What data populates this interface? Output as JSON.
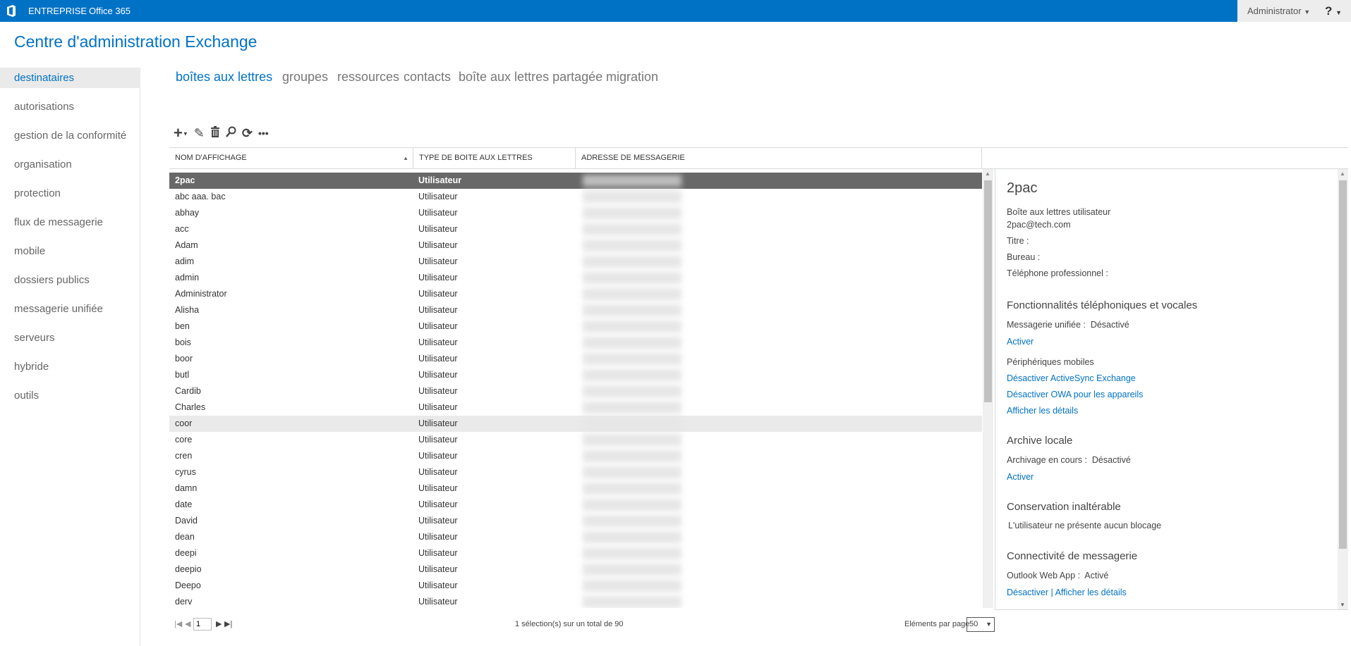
{
  "topbar": {
    "brand1": "ENTREPRISE",
    "brand2": "Office 365",
    "user": "Administrator",
    "help": "?",
    "logo_icon": "office-logo-icon",
    "accent": "#0072c6"
  },
  "title": "Centre d'administration Exchange",
  "sidebar": {
    "items": [
      {
        "label": "destinataires",
        "selected": true
      },
      {
        "label": "autorisations"
      },
      {
        "label": "gestion de la conformité"
      },
      {
        "label": "organisation"
      },
      {
        "label": "protection"
      },
      {
        "label": "flux de messagerie"
      },
      {
        "label": "mobile"
      },
      {
        "label": "dossiers publics"
      },
      {
        "label": "messagerie unifiée"
      },
      {
        "label": "serveurs"
      },
      {
        "label": "hybride"
      },
      {
        "label": "outils"
      }
    ]
  },
  "tabs": [
    {
      "label": "boîtes aux lettres",
      "selected": true
    },
    {
      "label": "groupes"
    },
    {
      "label": "ressources"
    },
    {
      "label": "contacts"
    },
    {
      "label": "boîte aux lettres partagée"
    },
    {
      "label": "migration"
    }
  ],
  "toolbar": {
    "icons": [
      "add-icon",
      "edit-icon",
      "delete-icon",
      "search-icon",
      "refresh-icon",
      "more-icon"
    ]
  },
  "grid": {
    "columns": [
      "NOM D'AFFICHAGE",
      "TYPE DE BOITE AUX LETTRES",
      "ADRESSE DE MESSAGERIE"
    ],
    "sort": "ascending",
    "rows": [
      {
        "name": "2pac",
        "type": "Utilisateur",
        "selected": true
      },
      {
        "name": "abc aaa. bac",
        "type": "Utilisateur"
      },
      {
        "name": "abhay",
        "type": "Utilisateur"
      },
      {
        "name": "acc",
        "type": "Utilisateur"
      },
      {
        "name": "Adam",
        "type": "Utilisateur"
      },
      {
        "name": "adim",
        "type": "Utilisateur"
      },
      {
        "name": "admin",
        "type": "Utilisateur"
      },
      {
        "name": "Administrator",
        "type": "Utilisateur"
      },
      {
        "name": "Alisha",
        "type": "Utilisateur"
      },
      {
        "name": "ben",
        "type": "Utilisateur"
      },
      {
        "name": "bois",
        "type": "Utilisateur"
      },
      {
        "name": "boor",
        "type": "Utilisateur"
      },
      {
        "name": "butl",
        "type": "Utilisateur"
      },
      {
        "name": "Cardib",
        "type": "Utilisateur"
      },
      {
        "name": "Charles",
        "type": "Utilisateur"
      },
      {
        "name": "coor",
        "type": "Utilisateur",
        "hover": true
      },
      {
        "name": "core",
        "type": "Utilisateur"
      },
      {
        "name": "cren",
        "type": "Utilisateur"
      },
      {
        "name": "cyrus",
        "type": "Utilisateur"
      },
      {
        "name": "damn",
        "type": "Utilisateur"
      },
      {
        "name": "date",
        "type": "Utilisateur"
      },
      {
        "name": "David",
        "type": "Utilisateur"
      },
      {
        "name": "dean",
        "type": "Utilisateur"
      },
      {
        "name": "deepi",
        "type": "Utilisateur"
      },
      {
        "name": "deepio",
        "type": "Utilisateur"
      },
      {
        "name": "Deepo",
        "type": "Utilisateur"
      },
      {
        "name": "derv",
        "type": "Utilisateur"
      }
    ]
  },
  "detail": {
    "name": "2pac",
    "type": "Boîte aux lettres utilisateur",
    "email": "2pac@tech.com",
    "titre": "Titre :",
    "bureau": "Bureau :",
    "telephone": "Téléphone professionnel :",
    "phone_heading": "Fonctionnalités téléphoniques et vocales",
    "um_label": "Messagerie unifiée :",
    "um_value": "Désactivé",
    "um_link": "Activer",
    "mobile_heading": "Périphériques mobiles",
    "mobile_link1": "Désactiver ActiveSync Exchange",
    "mobile_link2": "Désactiver OWA pour les appareils",
    "mobile_link3": "Afficher les détails",
    "archive_heading": "Archive locale",
    "archive_label": "Archivage en cours :",
    "archive_value": "Désactivé",
    "archive_link": "Activer",
    "hold_heading": "Conservation inaltérable",
    "hold_text": "L'utilisateur ne présente aucun blocage",
    "conn_heading": "Connectivité de messagerie",
    "owa_label": "Outlook Web App :",
    "owa_value": "Activé",
    "owa_link1": "Désactiver",
    "owa_sep": "|",
    "owa_link2": "Afficher les détails"
  },
  "footer": {
    "page": "1",
    "status": "1 sélection(s) sur un total de 90",
    "per_page_label": "Eléments par page",
    "per_page": "50"
  }
}
